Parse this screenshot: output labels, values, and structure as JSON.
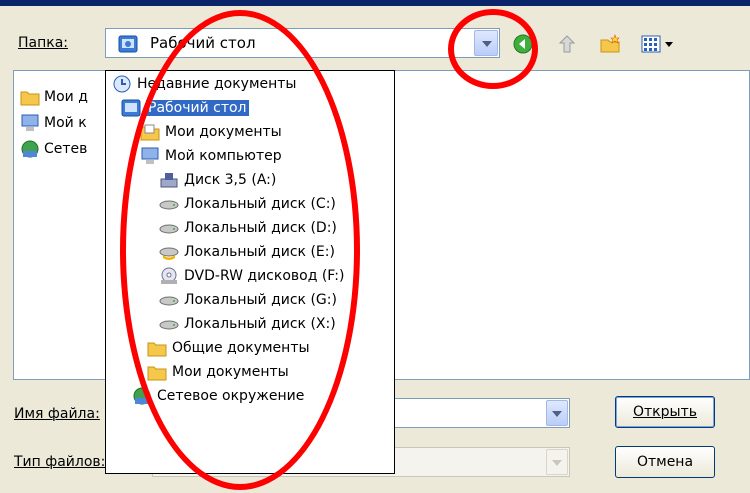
{
  "dialog": {
    "folder_label": "Папка:",
    "folder_value": "Рабочий стол",
    "filename_label": "Имя файла:",
    "filetype_label": "Тип файлов:",
    "open_button": "Открыть",
    "cancel_button": "Отмена"
  },
  "background_list": {
    "items": [
      "Мои д",
      "Мой к",
      "Сетев"
    ]
  },
  "dropdown": {
    "items": [
      {
        "label": "Недавние документы",
        "icon": "recent-documents-icon"
      },
      {
        "label": "Рабочий стол",
        "icon": "desktop-icon",
        "selected": true
      },
      {
        "label": "Мои документы",
        "icon": "my-documents-folder-icon"
      },
      {
        "label": "Мой компьютер",
        "icon": "my-computer-icon"
      },
      {
        "label": "Диск 3,5 (A:)",
        "icon": "floppy-drive-icon"
      },
      {
        "label": "Локальный диск (C:)",
        "icon": "hard-drive-icon"
      },
      {
        "label": "Локальный диск (D:)",
        "icon": "hard-drive-icon"
      },
      {
        "label": "Локальный диск (E:)",
        "icon": "shared-drive-icon"
      },
      {
        "label": "DVD-RW дисковод (F:)",
        "icon": "dvd-drive-icon"
      },
      {
        "label": "Локальный диск (G:)",
        "icon": "hard-drive-icon"
      },
      {
        "label": "Локальный диск (X:)",
        "icon": "hard-drive-icon"
      },
      {
        "label": "Общие документы",
        "icon": "folder-icon"
      },
      {
        "label": "Мои документы",
        "icon": "folder-icon"
      },
      {
        "label": "Сетевое окружение",
        "icon": "network-places-icon"
      }
    ]
  },
  "colors": {
    "selection": "#316ac5",
    "annotation": "#ff0000",
    "dialog_bg": "#ece9d8"
  }
}
